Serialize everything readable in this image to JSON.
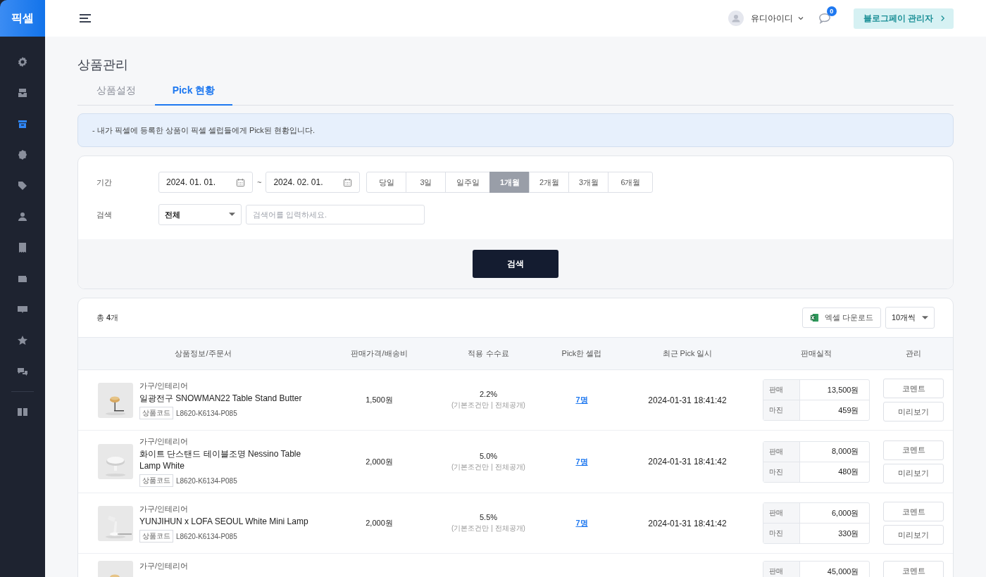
{
  "brand": "픽셀",
  "sidebar": {
    "items": [
      {
        "selected": false
      },
      {
        "selected": false
      },
      {
        "selected": true
      },
      {
        "selected": false
      },
      {
        "selected": false
      },
      {
        "selected": false
      },
      {
        "selected": false
      },
      {
        "selected": false
      },
      {
        "selected": false
      },
      {
        "selected": false
      },
      {
        "selected": false
      },
      {
        "selected": false
      }
    ]
  },
  "topbar": {
    "user": "유디아이디",
    "notification_count": "0",
    "admin_button": "블로그페이 관리자"
  },
  "page_title": "상품관리",
  "tabs": [
    {
      "label": "상품설정",
      "selected": false
    },
    {
      "label": "Pick 현황",
      "selected": true
    }
  ],
  "notice": "- 내가 픽셀에 등록한 상품이 픽셀 셀럽들에게 Pick된 현황입니다.",
  "filter": {
    "period_label": "기간",
    "start_date": "2024. 01. 01.",
    "separator": "~",
    "end_date": "2024. 02. 01.",
    "ranges": [
      {
        "label": "당일",
        "selected": false
      },
      {
        "label": "3일",
        "selected": false
      },
      {
        "label": "일주일",
        "selected": false
      },
      {
        "label": "1개월",
        "selected": true
      },
      {
        "label": "2개월",
        "selected": false
      },
      {
        "label": "3개월",
        "selected": false
      },
      {
        "label": "6개월",
        "selected": false
      }
    ],
    "search_label": "검색",
    "scope": "전체",
    "placeholder": "검색어를 입력하세요.",
    "search_button": "검색"
  },
  "results": {
    "total": "총 **4**개",
    "excel_button": "엑셀 다운로드",
    "page_size": "10개씩",
    "columns": [
      "상품정보/주문서",
      "판매가격/배송비",
      "적용 수수료",
      "Pick한 셀럽",
      "최근 Pick 일시",
      "판매실적",
      "관리"
    ],
    "rows": [
      {
        "category": "가구/인테리어",
        "name": "일광전구 SNOWMAN22 Table Stand Butter",
        "code_label": "상품코드",
        "code": "L8620-K6134-P085",
        "price": "1,500원",
        "rate": "2.2%",
        "rate_note": "(기본조건만 | 전체공개)",
        "pickers": "7명",
        "last_pick": "2024-01-31 18:41:42",
        "sales": [
          {
            "label": "판매",
            "value": "13,500원"
          },
          {
            "label": "마진",
            "value": "459원"
          }
        ],
        "actions": [
          "코멘트",
          "미리보기"
        ]
      },
      {
        "category": "가구/인테리어",
        "name": "화이트 단스탠드 테이블조명 Nessino Table Lamp White",
        "code_label": "상품코드",
        "code": "L8620-K6134-P085",
        "price": "2,000원",
        "rate": "5.0%",
        "rate_note": "(기본조건만 | 전체공개)",
        "pickers": "7명",
        "last_pick": "2024-01-31 18:41:42",
        "sales": [
          {
            "label": "판매",
            "value": "8,000원"
          },
          {
            "label": "마진",
            "value": "480원"
          }
        ],
        "actions": [
          "코멘트",
          "미리보기"
        ]
      },
      {
        "category": "가구/인테리어",
        "name": "YUNJIHUN x LOFA SEOUL White Mini Lamp",
        "code_label": "상품코드",
        "code": "L8620-K6134-P085",
        "price": "2,000원",
        "rate": "5.5%",
        "rate_note": "(기본조건만 | 전체공개)",
        "pickers": "7명",
        "last_pick": "2024-01-31 18:41:42",
        "sales": [
          {
            "label": "판매",
            "value": "6,000원"
          },
          {
            "label": "마진",
            "value": "330원"
          }
        ],
        "actions": [
          "코멘트",
          "미리보기"
        ]
      },
      {
        "category": "가구/인테리어",
        "sales": [
          {
            "label": "판매",
            "value": "45,000원"
          }
        ],
        "actions": [
          "코멘트"
        ]
      }
    ]
  }
}
